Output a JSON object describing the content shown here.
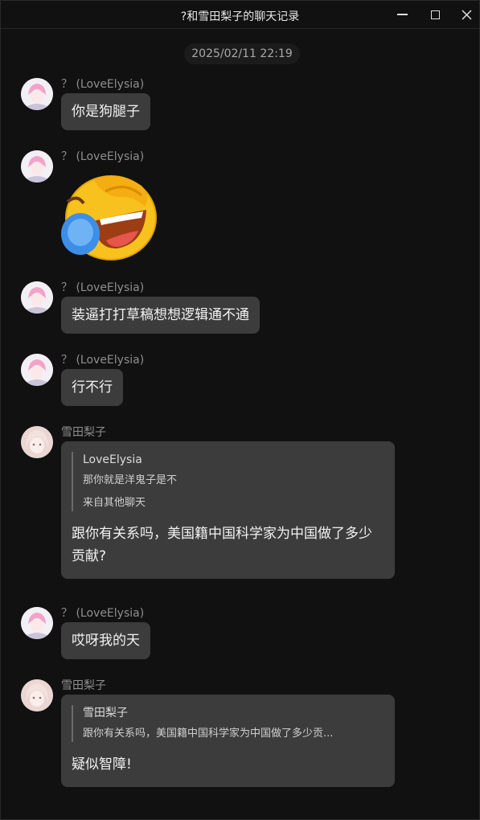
{
  "window": {
    "title": "?和雪田梨子的聊天记录"
  },
  "timestamp": "2025/02/11 22:19",
  "messages": [
    {
      "sender": "？ (LoveElysia)",
      "text": "你是狗腿子"
    },
    {
      "sender": "？ (LoveElysia)",
      "sticker": "laughing-crying-face-emoji"
    },
    {
      "sender": "？ (LoveElysia)",
      "text": "装逼打打草稿想想逻辑通不通"
    },
    {
      "sender": "？ (LoveElysia)",
      "text": "行不行"
    },
    {
      "sender": "雪田梨子",
      "quote": {
        "author": "LoveElysia",
        "text": "那你就是洋鬼子是不",
        "source": "来自其他聊天"
      },
      "text": "跟你有关系吗，美国籍中国科学家为中国做了多少贡献?"
    },
    {
      "sender": "？ (LoveElysia)",
      "text": "哎呀我的天"
    },
    {
      "sender": "雪田梨子",
      "quote": {
        "author": "雪田梨子",
        "text": "跟你有关系吗，美国籍中国科学家为中国做了多少贡..."
      },
      "text": "疑似智障!"
    }
  ],
  "colors": {
    "background": "#111111",
    "bubble": "#3c3c3c",
    "sender": "#8f8f8f"
  }
}
